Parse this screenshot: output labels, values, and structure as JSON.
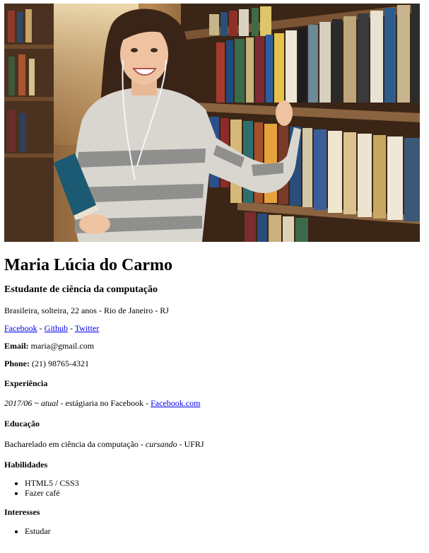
{
  "photo": {
    "alt": "Maria Lúcia do Carmo"
  },
  "profile": {
    "name": "Maria Lúcia do Carmo",
    "title": "Estudante de ciência da computação",
    "origin": "Brasileira, solteira, 22 anos - Rio de Janeiro - RJ"
  },
  "links": {
    "facebook": "Facebook",
    "github": "Github",
    "twitter": "Twitter",
    "separator": " - "
  },
  "contact": {
    "email_label": "Email:",
    "email_value": " maria@gmail.com",
    "phone_label": "Phone:",
    "phone_value": " (21) 98765-4321"
  },
  "experience": {
    "heading": "Experiência",
    "period": "2017/06 ~ atual",
    "description": " - estágiaria no Facebook - ",
    "company_link": "Facebook.com"
  },
  "education": {
    "heading": "Educação",
    "degree": "Bacharelado em ciência da computação - ",
    "status": "cursando",
    "institution": " - UFRJ"
  },
  "skills": {
    "heading": "Habilidades",
    "items": [
      "HTML5 / CSS3",
      "Fazer café"
    ]
  },
  "interests": {
    "heading": "Interesses",
    "items": [
      "Estudar"
    ]
  }
}
